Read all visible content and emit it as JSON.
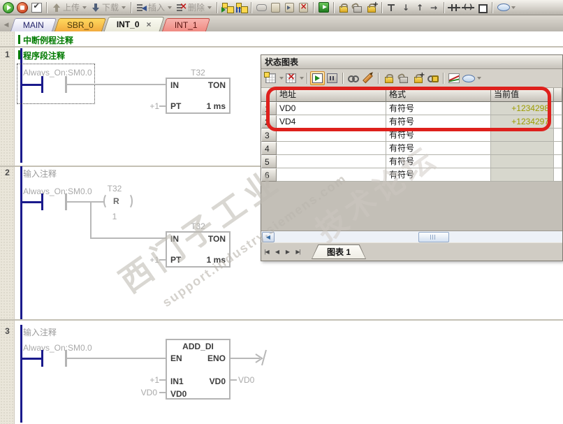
{
  "colors": {
    "annotation_red": "#de201c",
    "value_olive": "#9c9c00",
    "power_rail_navy": "#1a1a8c",
    "comment_green": "#007a00"
  },
  "main_toolbar": {
    "upload_label": "上传",
    "download_label": "下载",
    "insert_label": "插入",
    "delete_label": "删除",
    "icons": [
      "run-icon",
      "stop-icon",
      "compile-icon",
      "upload-icon",
      "download-icon",
      "insert-icon",
      "delete-icon",
      "program-status-icon",
      "chart-status-icon",
      "address-icon",
      "bookmark-toggle-icon",
      "bookmark-next-icon",
      "bookmark-clear-icon",
      "goto-icon",
      "force-icon",
      "unforce-icon",
      "force-all-icon",
      "insert-branch-icon",
      "line-down-icon",
      "line-up-icon",
      "line-right-icon",
      "contact-icon",
      "coil-icon",
      "box-icon",
      "ellipse-icon"
    ]
  },
  "tab_bar": {
    "scroll_left_glyph": "◀",
    "tabs": [
      {
        "label": "MAIN"
      },
      {
        "label": "SBR_0"
      },
      {
        "label": "INT_0",
        "close_glyph": "×"
      },
      {
        "label": "INT_1"
      }
    ]
  },
  "ladder": {
    "header_comment": "中断例程注释",
    "networks": [
      {
        "num": "1",
        "comment": "程序段注释",
        "contact_label": "Always_On:SM0.0",
        "timer": {
          "tag": "T32",
          "in": "IN",
          "type": "TON",
          "pt": "PT",
          "pt_operand": "+1",
          "preset": "1 ms"
        }
      },
      {
        "num": "2",
        "comment": "输入注释",
        "contact_label": "Always_On:SM0.0",
        "coil": {
          "tag": "T32",
          "letter": "R",
          "operand": "1"
        },
        "timer": {
          "tag": "T32",
          "in": "IN",
          "type": "TON",
          "pt": "PT",
          "pt_operand": "+1",
          "preset": "1 ms"
        }
      },
      {
        "num": "3",
        "comment": "输入注释",
        "contact_label": "Always_On:SM0.0",
        "box": {
          "title": "ADD_DI",
          "en": "EN",
          "eno": "ENO",
          "in1": "IN1",
          "in1_operand": "+1",
          "in2": "VD0",
          "in2_operand": "VD0",
          "out": "VD0",
          "out_operand": "VD0"
        }
      }
    ]
  },
  "status_window": {
    "title": "状态图表",
    "toolbar_icons": [
      "new-chart-icon",
      "delete-chart-icon",
      "status-on-icon",
      "pause-icon",
      "read-all-icon",
      "write-icon",
      "force-icon",
      "unforce-icon",
      "force-all-icon",
      "read-forced-icon",
      "trend-view-icon",
      "ellipse-icon"
    ],
    "table": {
      "headers": [
        "地址",
        "格式",
        "当前值"
      ],
      "rows": [
        {
          "num": "1",
          "addr": "VD0",
          "fmt": "有符号",
          "val": "+1234298"
        },
        {
          "num": "2",
          "addr": "VD4",
          "fmt": "有符号",
          "val": "+1234297"
        },
        {
          "num": "3",
          "addr": "",
          "fmt": "有符号",
          "val": ""
        },
        {
          "num": "4",
          "addr": "",
          "fmt": "有符号",
          "val": ""
        },
        {
          "num": "5",
          "addr": "",
          "fmt": "有符号",
          "val": ""
        },
        {
          "num": "6",
          "addr": "",
          "fmt": "有符号",
          "val": ""
        }
      ]
    },
    "nav": {
      "first": "|◀",
      "prev": "◀",
      "next": "▶",
      "last": "▶|"
    },
    "sheet_tab": "图表 1"
  },
  "watermarks": {
    "brand": "西门子工业",
    "url": "support.industry.siemens.com",
    "forum": "技术论坛"
  }
}
